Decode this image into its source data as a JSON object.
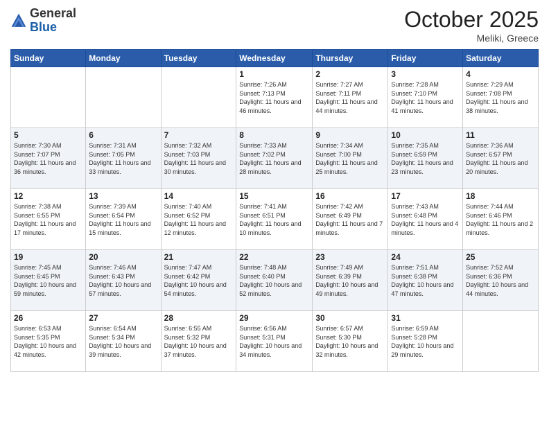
{
  "header": {
    "logo_general": "General",
    "logo_blue": "Blue",
    "month": "October 2025",
    "location": "Meliki, Greece"
  },
  "weekdays": [
    "Sunday",
    "Monday",
    "Tuesday",
    "Wednesday",
    "Thursday",
    "Friday",
    "Saturday"
  ],
  "weeks": [
    [
      {
        "day": "",
        "sunrise": "",
        "sunset": "",
        "daylight": ""
      },
      {
        "day": "",
        "sunrise": "",
        "sunset": "",
        "daylight": ""
      },
      {
        "day": "",
        "sunrise": "",
        "sunset": "",
        "daylight": ""
      },
      {
        "day": "1",
        "sunrise": "Sunrise: 7:26 AM",
        "sunset": "Sunset: 7:13 PM",
        "daylight": "Daylight: 11 hours and 46 minutes."
      },
      {
        "day": "2",
        "sunrise": "Sunrise: 7:27 AM",
        "sunset": "Sunset: 7:11 PM",
        "daylight": "Daylight: 11 hours and 44 minutes."
      },
      {
        "day": "3",
        "sunrise": "Sunrise: 7:28 AM",
        "sunset": "Sunset: 7:10 PM",
        "daylight": "Daylight: 11 hours and 41 minutes."
      },
      {
        "day": "4",
        "sunrise": "Sunrise: 7:29 AM",
        "sunset": "Sunset: 7:08 PM",
        "daylight": "Daylight: 11 hours and 38 minutes."
      }
    ],
    [
      {
        "day": "5",
        "sunrise": "Sunrise: 7:30 AM",
        "sunset": "Sunset: 7:07 PM",
        "daylight": "Daylight: 11 hours and 36 minutes."
      },
      {
        "day": "6",
        "sunrise": "Sunrise: 7:31 AM",
        "sunset": "Sunset: 7:05 PM",
        "daylight": "Daylight: 11 hours and 33 minutes."
      },
      {
        "day": "7",
        "sunrise": "Sunrise: 7:32 AM",
        "sunset": "Sunset: 7:03 PM",
        "daylight": "Daylight: 11 hours and 30 minutes."
      },
      {
        "day": "8",
        "sunrise": "Sunrise: 7:33 AM",
        "sunset": "Sunset: 7:02 PM",
        "daylight": "Daylight: 11 hours and 28 minutes."
      },
      {
        "day": "9",
        "sunrise": "Sunrise: 7:34 AM",
        "sunset": "Sunset: 7:00 PM",
        "daylight": "Daylight: 11 hours and 25 minutes."
      },
      {
        "day": "10",
        "sunrise": "Sunrise: 7:35 AM",
        "sunset": "Sunset: 6:59 PM",
        "daylight": "Daylight: 11 hours and 23 minutes."
      },
      {
        "day": "11",
        "sunrise": "Sunrise: 7:36 AM",
        "sunset": "Sunset: 6:57 PM",
        "daylight": "Daylight: 11 hours and 20 minutes."
      }
    ],
    [
      {
        "day": "12",
        "sunrise": "Sunrise: 7:38 AM",
        "sunset": "Sunset: 6:55 PM",
        "daylight": "Daylight: 11 hours and 17 minutes."
      },
      {
        "day": "13",
        "sunrise": "Sunrise: 7:39 AM",
        "sunset": "Sunset: 6:54 PM",
        "daylight": "Daylight: 11 hours and 15 minutes."
      },
      {
        "day": "14",
        "sunrise": "Sunrise: 7:40 AM",
        "sunset": "Sunset: 6:52 PM",
        "daylight": "Daylight: 11 hours and 12 minutes."
      },
      {
        "day": "15",
        "sunrise": "Sunrise: 7:41 AM",
        "sunset": "Sunset: 6:51 PM",
        "daylight": "Daylight: 11 hours and 10 minutes."
      },
      {
        "day": "16",
        "sunrise": "Sunrise: 7:42 AM",
        "sunset": "Sunset: 6:49 PM",
        "daylight": "Daylight: 11 hours and 7 minutes."
      },
      {
        "day": "17",
        "sunrise": "Sunrise: 7:43 AM",
        "sunset": "Sunset: 6:48 PM",
        "daylight": "Daylight: 11 hours and 4 minutes."
      },
      {
        "day": "18",
        "sunrise": "Sunrise: 7:44 AM",
        "sunset": "Sunset: 6:46 PM",
        "daylight": "Daylight: 11 hours and 2 minutes."
      }
    ],
    [
      {
        "day": "19",
        "sunrise": "Sunrise: 7:45 AM",
        "sunset": "Sunset: 6:45 PM",
        "daylight": "Daylight: 10 hours and 59 minutes."
      },
      {
        "day": "20",
        "sunrise": "Sunrise: 7:46 AM",
        "sunset": "Sunset: 6:43 PM",
        "daylight": "Daylight: 10 hours and 57 minutes."
      },
      {
        "day": "21",
        "sunrise": "Sunrise: 7:47 AM",
        "sunset": "Sunset: 6:42 PM",
        "daylight": "Daylight: 10 hours and 54 minutes."
      },
      {
        "day": "22",
        "sunrise": "Sunrise: 7:48 AM",
        "sunset": "Sunset: 6:40 PM",
        "daylight": "Daylight: 10 hours and 52 minutes."
      },
      {
        "day": "23",
        "sunrise": "Sunrise: 7:49 AM",
        "sunset": "Sunset: 6:39 PM",
        "daylight": "Daylight: 10 hours and 49 minutes."
      },
      {
        "day": "24",
        "sunrise": "Sunrise: 7:51 AM",
        "sunset": "Sunset: 6:38 PM",
        "daylight": "Daylight: 10 hours and 47 minutes."
      },
      {
        "day": "25",
        "sunrise": "Sunrise: 7:52 AM",
        "sunset": "Sunset: 6:36 PM",
        "daylight": "Daylight: 10 hours and 44 minutes."
      }
    ],
    [
      {
        "day": "26",
        "sunrise": "Sunrise: 6:53 AM",
        "sunset": "Sunset: 5:35 PM",
        "daylight": "Daylight: 10 hours and 42 minutes."
      },
      {
        "day": "27",
        "sunrise": "Sunrise: 6:54 AM",
        "sunset": "Sunset: 5:34 PM",
        "daylight": "Daylight: 10 hours and 39 minutes."
      },
      {
        "day": "28",
        "sunrise": "Sunrise: 6:55 AM",
        "sunset": "Sunset: 5:32 PM",
        "daylight": "Daylight: 10 hours and 37 minutes."
      },
      {
        "day": "29",
        "sunrise": "Sunrise: 6:56 AM",
        "sunset": "Sunset: 5:31 PM",
        "daylight": "Daylight: 10 hours and 34 minutes."
      },
      {
        "day": "30",
        "sunrise": "Sunrise: 6:57 AM",
        "sunset": "Sunset: 5:30 PM",
        "daylight": "Daylight: 10 hours and 32 minutes."
      },
      {
        "day": "31",
        "sunrise": "Sunrise: 6:59 AM",
        "sunset": "Sunset: 5:28 PM",
        "daylight": "Daylight: 10 hours and 29 minutes."
      },
      {
        "day": "",
        "sunrise": "",
        "sunset": "",
        "daylight": ""
      }
    ]
  ]
}
